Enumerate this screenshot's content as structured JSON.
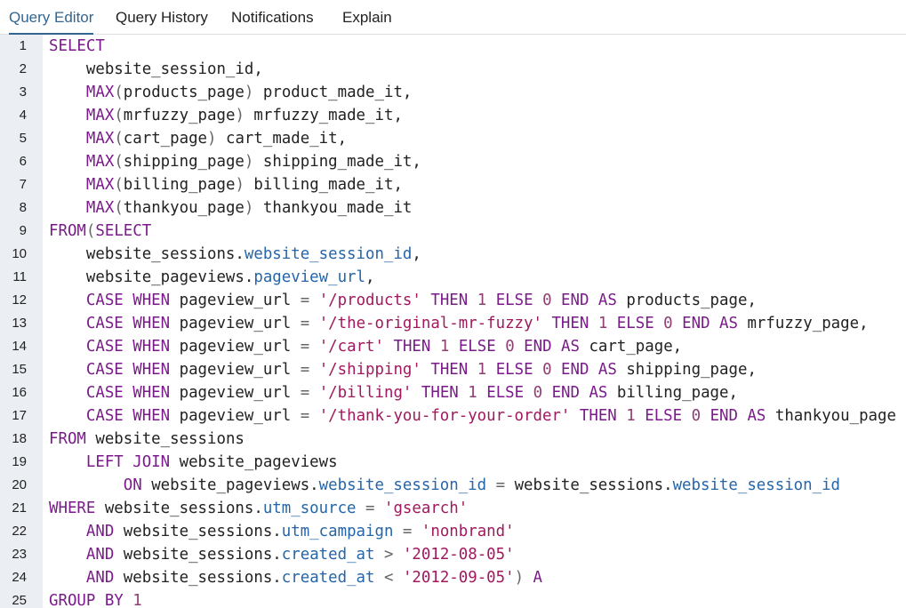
{
  "tabs": [
    {
      "label": "Query Editor",
      "active": true
    },
    {
      "label": "Query History",
      "active": false
    },
    {
      "label": "Notifications",
      "active": false
    },
    {
      "label": "Explain",
      "active": false
    }
  ],
  "colors": {
    "accent": "#326690",
    "keyword": "#7b1a8b",
    "string": "#a0195e",
    "number": "#8f3e72",
    "property": "#2565a8",
    "gutter_bg": "#ebeef3"
  },
  "editor": {
    "lines": [
      {
        "n": "1",
        "tokens": [
          {
            "t": "SELECT",
            "c": "kw"
          }
        ]
      },
      {
        "n": "2",
        "tokens": [
          {
            "t": "    website_session_id,",
            "c": "pl"
          }
        ]
      },
      {
        "n": "3",
        "tokens": [
          {
            "t": "    ",
            "c": "pl"
          },
          {
            "t": "MAX",
            "c": "kw"
          },
          {
            "t": "(",
            "c": "pn"
          },
          {
            "t": "products_page",
            "c": "pl"
          },
          {
            "t": ")",
            "c": "pn"
          },
          {
            "t": " product_made_it,",
            "c": "pl"
          }
        ]
      },
      {
        "n": "4",
        "tokens": [
          {
            "t": "    ",
            "c": "pl"
          },
          {
            "t": "MAX",
            "c": "kw"
          },
          {
            "t": "(",
            "c": "pn"
          },
          {
            "t": "mrfuzzy_page",
            "c": "pl"
          },
          {
            "t": ")",
            "c": "pn"
          },
          {
            "t": " mrfuzzy_made_it,",
            "c": "pl"
          }
        ]
      },
      {
        "n": "5",
        "tokens": [
          {
            "t": "    ",
            "c": "pl"
          },
          {
            "t": "MAX",
            "c": "kw"
          },
          {
            "t": "(",
            "c": "pn"
          },
          {
            "t": "cart_page",
            "c": "pl"
          },
          {
            "t": ")",
            "c": "pn"
          },
          {
            "t": " cart_made_it,",
            "c": "pl"
          }
        ]
      },
      {
        "n": "6",
        "tokens": [
          {
            "t": "    ",
            "c": "pl"
          },
          {
            "t": "MAX",
            "c": "kw"
          },
          {
            "t": "(",
            "c": "pn"
          },
          {
            "t": "shipping_page",
            "c": "pl"
          },
          {
            "t": ")",
            "c": "pn"
          },
          {
            "t": " shipping_made_it,",
            "c": "pl"
          }
        ]
      },
      {
        "n": "7",
        "tokens": [
          {
            "t": "    ",
            "c": "pl"
          },
          {
            "t": "MAX",
            "c": "kw"
          },
          {
            "t": "(",
            "c": "pn"
          },
          {
            "t": "billing_page",
            "c": "pl"
          },
          {
            "t": ")",
            "c": "pn"
          },
          {
            "t": " billing_made_it,",
            "c": "pl"
          }
        ]
      },
      {
        "n": "8",
        "tokens": [
          {
            "t": "    ",
            "c": "pl"
          },
          {
            "t": "MAX",
            "c": "kw"
          },
          {
            "t": "(",
            "c": "pn"
          },
          {
            "t": "thankyou_page",
            "c": "pl"
          },
          {
            "t": ")",
            "c": "pn"
          },
          {
            "t": " thankyou_made_it",
            "c": "pl"
          }
        ]
      },
      {
        "n": "9",
        "tokens": [
          {
            "t": "FROM",
            "c": "kw"
          },
          {
            "t": "(",
            "c": "pn"
          },
          {
            "t": "SELECT",
            "c": "kw"
          }
        ]
      },
      {
        "n": "10",
        "tokens": [
          {
            "t": "    website_sessions.",
            "c": "pl"
          },
          {
            "t": "website_session_id",
            "c": "prop"
          },
          {
            "t": ",",
            "c": "pl"
          }
        ]
      },
      {
        "n": "11",
        "tokens": [
          {
            "t": "    website_pageviews.",
            "c": "pl"
          },
          {
            "t": "pageview_url",
            "c": "prop"
          },
          {
            "t": ",",
            "c": "pl"
          }
        ]
      },
      {
        "n": "12",
        "tokens": [
          {
            "t": "    ",
            "c": "pl"
          },
          {
            "t": "CASE WHEN",
            "c": "kw"
          },
          {
            "t": " pageview_url ",
            "c": "pl"
          },
          {
            "t": "=",
            "c": "pn"
          },
          {
            "t": " ",
            "c": "pl"
          },
          {
            "t": "'/products'",
            "c": "str"
          },
          {
            "t": " ",
            "c": "pl"
          },
          {
            "t": "THEN",
            "c": "kw"
          },
          {
            "t": " ",
            "c": "pl"
          },
          {
            "t": "1",
            "c": "num"
          },
          {
            "t": " ",
            "c": "pl"
          },
          {
            "t": "ELSE",
            "c": "kw"
          },
          {
            "t": " ",
            "c": "pl"
          },
          {
            "t": "0",
            "c": "num"
          },
          {
            "t": " ",
            "c": "pl"
          },
          {
            "t": "END AS",
            "c": "kw"
          },
          {
            "t": " products_page,",
            "c": "pl"
          }
        ]
      },
      {
        "n": "13",
        "tokens": [
          {
            "t": "    ",
            "c": "pl"
          },
          {
            "t": "CASE WHEN",
            "c": "kw"
          },
          {
            "t": " pageview_url ",
            "c": "pl"
          },
          {
            "t": "=",
            "c": "pn"
          },
          {
            "t": " ",
            "c": "pl"
          },
          {
            "t": "'/the-original-mr-fuzzy'",
            "c": "str"
          },
          {
            "t": " ",
            "c": "pl"
          },
          {
            "t": "THEN",
            "c": "kw"
          },
          {
            "t": " ",
            "c": "pl"
          },
          {
            "t": "1",
            "c": "num"
          },
          {
            "t": " ",
            "c": "pl"
          },
          {
            "t": "ELSE",
            "c": "kw"
          },
          {
            "t": " ",
            "c": "pl"
          },
          {
            "t": "0",
            "c": "num"
          },
          {
            "t": " ",
            "c": "pl"
          },
          {
            "t": "END AS",
            "c": "kw"
          },
          {
            "t": " mrfuzzy_page,",
            "c": "pl"
          }
        ]
      },
      {
        "n": "14",
        "tokens": [
          {
            "t": "    ",
            "c": "pl"
          },
          {
            "t": "CASE WHEN",
            "c": "kw"
          },
          {
            "t": " pageview_url ",
            "c": "pl"
          },
          {
            "t": "=",
            "c": "pn"
          },
          {
            "t": " ",
            "c": "pl"
          },
          {
            "t": "'/cart'",
            "c": "str"
          },
          {
            "t": " ",
            "c": "pl"
          },
          {
            "t": "THEN",
            "c": "kw"
          },
          {
            "t": " ",
            "c": "pl"
          },
          {
            "t": "1",
            "c": "num"
          },
          {
            "t": " ",
            "c": "pl"
          },
          {
            "t": "ELSE",
            "c": "kw"
          },
          {
            "t": " ",
            "c": "pl"
          },
          {
            "t": "0",
            "c": "num"
          },
          {
            "t": " ",
            "c": "pl"
          },
          {
            "t": "END AS",
            "c": "kw"
          },
          {
            "t": " cart_page,",
            "c": "pl"
          }
        ]
      },
      {
        "n": "15",
        "tokens": [
          {
            "t": "    ",
            "c": "pl"
          },
          {
            "t": "CASE WHEN",
            "c": "kw"
          },
          {
            "t": " pageview_url ",
            "c": "pl"
          },
          {
            "t": "=",
            "c": "pn"
          },
          {
            "t": " ",
            "c": "pl"
          },
          {
            "t": "'/shipping'",
            "c": "str"
          },
          {
            "t": " ",
            "c": "pl"
          },
          {
            "t": "THEN",
            "c": "kw"
          },
          {
            "t": " ",
            "c": "pl"
          },
          {
            "t": "1",
            "c": "num"
          },
          {
            "t": " ",
            "c": "pl"
          },
          {
            "t": "ELSE",
            "c": "kw"
          },
          {
            "t": " ",
            "c": "pl"
          },
          {
            "t": "0",
            "c": "num"
          },
          {
            "t": " ",
            "c": "pl"
          },
          {
            "t": "END AS",
            "c": "kw"
          },
          {
            "t": " shipping_page,",
            "c": "pl"
          }
        ]
      },
      {
        "n": "16",
        "tokens": [
          {
            "t": "    ",
            "c": "pl"
          },
          {
            "t": "CASE WHEN",
            "c": "kw"
          },
          {
            "t": " pageview_url ",
            "c": "pl"
          },
          {
            "t": "=",
            "c": "pn"
          },
          {
            "t": " ",
            "c": "pl"
          },
          {
            "t": "'/billing'",
            "c": "str"
          },
          {
            "t": " ",
            "c": "pl"
          },
          {
            "t": "THEN",
            "c": "kw"
          },
          {
            "t": " ",
            "c": "pl"
          },
          {
            "t": "1",
            "c": "num"
          },
          {
            "t": " ",
            "c": "pl"
          },
          {
            "t": "ELSE",
            "c": "kw"
          },
          {
            "t": " ",
            "c": "pl"
          },
          {
            "t": "0",
            "c": "num"
          },
          {
            "t": " ",
            "c": "pl"
          },
          {
            "t": "END AS",
            "c": "kw"
          },
          {
            "t": " billing_page,",
            "c": "pl"
          }
        ]
      },
      {
        "n": "17",
        "tokens": [
          {
            "t": "    ",
            "c": "pl"
          },
          {
            "t": "CASE WHEN",
            "c": "kw"
          },
          {
            "t": " pageview_url ",
            "c": "pl"
          },
          {
            "t": "=",
            "c": "pn"
          },
          {
            "t": " ",
            "c": "pl"
          },
          {
            "t": "'/thank-you-for-your-order'",
            "c": "str"
          },
          {
            "t": " ",
            "c": "pl"
          },
          {
            "t": "THEN",
            "c": "kw"
          },
          {
            "t": " ",
            "c": "pl"
          },
          {
            "t": "1",
            "c": "num"
          },
          {
            "t": " ",
            "c": "pl"
          },
          {
            "t": "ELSE",
            "c": "kw"
          },
          {
            "t": " ",
            "c": "pl"
          },
          {
            "t": "0",
            "c": "num"
          },
          {
            "t": " ",
            "c": "pl"
          },
          {
            "t": "END AS",
            "c": "kw"
          },
          {
            "t": " thankyou_page",
            "c": "pl"
          }
        ]
      },
      {
        "n": "18",
        "tokens": [
          {
            "t": "FROM",
            "c": "kw"
          },
          {
            "t": " website_sessions",
            "c": "pl"
          }
        ]
      },
      {
        "n": "19",
        "tokens": [
          {
            "t": "    ",
            "c": "pl"
          },
          {
            "t": "LEFT JOIN",
            "c": "kw"
          },
          {
            "t": " website_pageviews",
            "c": "pl"
          }
        ]
      },
      {
        "n": "20",
        "tokens": [
          {
            "t": "        ",
            "c": "pl"
          },
          {
            "t": "ON",
            "c": "kw"
          },
          {
            "t": " website_pageviews.",
            "c": "pl"
          },
          {
            "t": "website_session_id",
            "c": "prop"
          },
          {
            "t": " ",
            "c": "pl"
          },
          {
            "t": "=",
            "c": "pn"
          },
          {
            "t": " website_sessions.",
            "c": "pl"
          },
          {
            "t": "website_session_id",
            "c": "prop"
          }
        ]
      },
      {
        "n": "21",
        "tokens": [
          {
            "t": "WHERE",
            "c": "kw"
          },
          {
            "t": " website_sessions.",
            "c": "pl"
          },
          {
            "t": "utm_source",
            "c": "prop"
          },
          {
            "t": " ",
            "c": "pl"
          },
          {
            "t": "=",
            "c": "pn"
          },
          {
            "t": " ",
            "c": "pl"
          },
          {
            "t": "'gsearch'",
            "c": "str"
          }
        ]
      },
      {
        "n": "22",
        "tokens": [
          {
            "t": "    ",
            "c": "pl"
          },
          {
            "t": "AND",
            "c": "kw"
          },
          {
            "t": " website_sessions.",
            "c": "pl"
          },
          {
            "t": "utm_campaign",
            "c": "prop"
          },
          {
            "t": " ",
            "c": "pl"
          },
          {
            "t": "=",
            "c": "pn"
          },
          {
            "t": " ",
            "c": "pl"
          },
          {
            "t": "'nonbrand'",
            "c": "str"
          }
        ]
      },
      {
        "n": "23",
        "tokens": [
          {
            "t": "    ",
            "c": "pl"
          },
          {
            "t": "AND",
            "c": "kw"
          },
          {
            "t": " website_sessions.",
            "c": "pl"
          },
          {
            "t": "created_at",
            "c": "prop"
          },
          {
            "t": " ",
            "c": "pl"
          },
          {
            "t": ">",
            "c": "pn"
          },
          {
            "t": " ",
            "c": "pl"
          },
          {
            "t": "'2012-08-05'",
            "c": "str"
          }
        ]
      },
      {
        "n": "24",
        "tokens": [
          {
            "t": "    ",
            "c": "pl"
          },
          {
            "t": "AND",
            "c": "kw"
          },
          {
            "t": " website_sessions.",
            "c": "pl"
          },
          {
            "t": "created_at",
            "c": "prop"
          },
          {
            "t": " ",
            "c": "pl"
          },
          {
            "t": "<",
            "c": "pn"
          },
          {
            "t": " ",
            "c": "pl"
          },
          {
            "t": "'2012-09-05'",
            "c": "str"
          },
          {
            "t": ")",
            "c": "pn"
          },
          {
            "t": " ",
            "c": "pl"
          },
          {
            "t": "A",
            "c": "kw"
          }
        ]
      },
      {
        "n": "25",
        "tokens": [
          {
            "t": "GROUP BY",
            "c": "kw"
          },
          {
            "t": " ",
            "c": "pl"
          },
          {
            "t": "1",
            "c": "num"
          }
        ]
      }
    ]
  }
}
